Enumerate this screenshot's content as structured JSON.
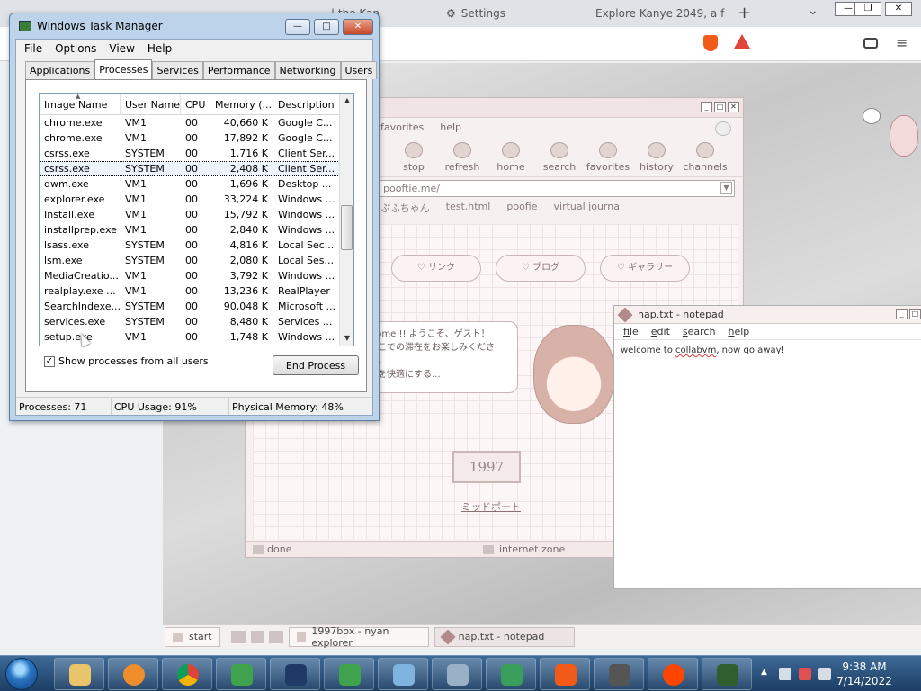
{
  "browser": {
    "tabs": [
      {
        "label": "| the Kan"
      },
      {
        "label": "Settings"
      },
      {
        "label": "Explore Kanye 2049, a f"
      }
    ],
    "new_tab": "+",
    "tab_list": "⌄"
  },
  "taskmgr": {
    "title": "Windows Task Manager",
    "menu": [
      "File",
      "Options",
      "View",
      "Help"
    ],
    "tabs": [
      "Applications",
      "Processes",
      "Services",
      "Performance",
      "Networking",
      "Users"
    ],
    "active_tab": "Processes",
    "columns": [
      "Image Name",
      "User Name",
      "CPU",
      "Memory (...",
      "Description"
    ],
    "rows": [
      {
        "name": "chrome.exe",
        "user": "VM1",
        "cpu": "00",
        "mem": "40,660 K",
        "desc": "Google C..."
      },
      {
        "name": "chrome.exe",
        "user": "VM1",
        "cpu": "00",
        "mem": "17,892 K",
        "desc": "Google C..."
      },
      {
        "name": "csrss.exe",
        "user": "SYSTEM",
        "cpu": "00",
        "mem": "1,716 K",
        "desc": "Client Ser..."
      },
      {
        "name": "csrss.exe",
        "user": "SYSTEM",
        "cpu": "00",
        "mem": "2,408 K",
        "desc": "Client Ser...",
        "selected": true
      },
      {
        "name": "dwm.exe",
        "user": "VM1",
        "cpu": "00",
        "mem": "1,696 K",
        "desc": "Desktop ..."
      },
      {
        "name": "explorer.exe",
        "user": "VM1",
        "cpu": "00",
        "mem": "33,224 K",
        "desc": "Windows ..."
      },
      {
        "name": "Install.exe",
        "user": "VM1",
        "cpu": "00",
        "mem": "15,792 K",
        "desc": "Windows ..."
      },
      {
        "name": "installprep.exe",
        "user": "VM1",
        "cpu": "00",
        "mem": "2,840 K",
        "desc": "Windows ..."
      },
      {
        "name": "lsass.exe",
        "user": "SYSTEM",
        "cpu": "00",
        "mem": "4,816 K",
        "desc": "Local Sec..."
      },
      {
        "name": "lsm.exe",
        "user": "SYSTEM",
        "cpu": "00",
        "mem": "2,080 K",
        "desc": "Local Ses..."
      },
      {
        "name": "MediaCreatio...",
        "user": "VM1",
        "cpu": "00",
        "mem": "3,792 K",
        "desc": "Windows ..."
      },
      {
        "name": "realplay.exe ...",
        "user": "VM1",
        "cpu": "00",
        "mem": "13,236 K",
        "desc": "RealPlayer"
      },
      {
        "name": "SearchIndexe...",
        "user": "SYSTEM",
        "cpu": "00",
        "mem": "90,048 K",
        "desc": "Microsoft ..."
      },
      {
        "name": "services.exe",
        "user": "SYSTEM",
        "cpu": "00",
        "mem": "8,480 K",
        "desc": "Services ..."
      },
      {
        "name": "setup.exe",
        "user": "VM1",
        "cpu": "00",
        "mem": "1,748 K",
        "desc": "Windows ..."
      }
    ],
    "show_all_label": "Show processes from all users",
    "show_all_checked": "✓",
    "end_process": "End Process",
    "status": {
      "processes": "Processes: 71",
      "cpu": "CPU Usage: 91%",
      "memory": "Physical Memory: 48%"
    }
  },
  "nyan": {
    "menu": [
      "favorites",
      "help"
    ],
    "tools": [
      "stop",
      "refresh",
      "home",
      "search",
      "favorites",
      "history",
      "channels"
    ],
    "address": "pooftie.me/",
    "links": [
      "ぷふちゃん",
      "test.html",
      "poofie",
      "virtual journal"
    ],
    "heart_buttons": [
      "リンク",
      "ブログ",
      "ギャラリー"
    ],
    "bubble_lines": [
      "lcome !! ようこそ、ゲスト！",
      "ここでの滞在をお楽しみください。",
      "分を快適にする..."
    ],
    "counter": "1997",
    "midpoint": "ミッドポート",
    "status_done": "done",
    "status_zone": "internet zone"
  },
  "notepad": {
    "title": "nap.txt - notepad",
    "menu": [
      "file",
      "edit",
      "search",
      "help"
    ],
    "text_before": "welcome to ",
    "text_link": "collabvm",
    "text_after": ", now go away!"
  },
  "page_taskbar": {
    "start": "start",
    "tasks": [
      "1997box - nyan explorer",
      "nap.txt - notepad"
    ]
  },
  "win_taskbar": {
    "time": "9:38 AM",
    "date": "7/14/2022"
  }
}
